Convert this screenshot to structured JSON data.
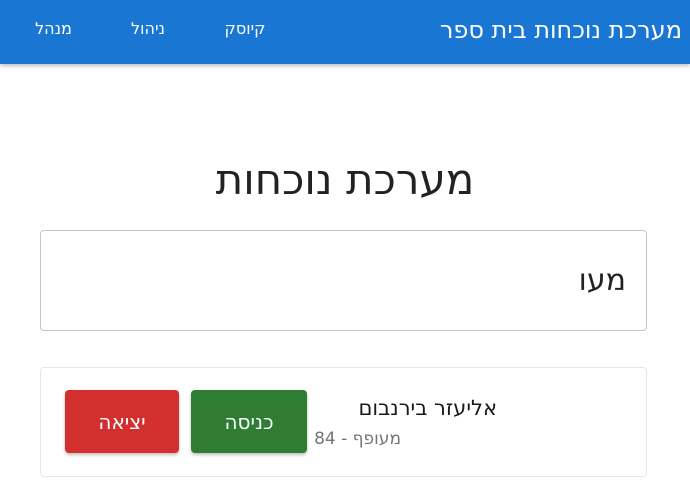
{
  "header": {
    "app_title": "מערכת נוכחות בית ספר",
    "nav": {
      "kiosk": "קיוסק",
      "manage": "ניהול",
      "admin": "מנהל"
    },
    "background_color": "#1976d2"
  },
  "main": {
    "page_title": "מערכת נוכחות",
    "search": {
      "value": "מעו"
    },
    "results": [
      {
        "name": "אליעזר בירנבום",
        "meta": "מעופף - 84",
        "enter_label": "כניסה",
        "exit_label": "יציאה"
      }
    ]
  },
  "colors": {
    "enter_button": "#2e7d32",
    "exit_button": "#d32f2f"
  }
}
